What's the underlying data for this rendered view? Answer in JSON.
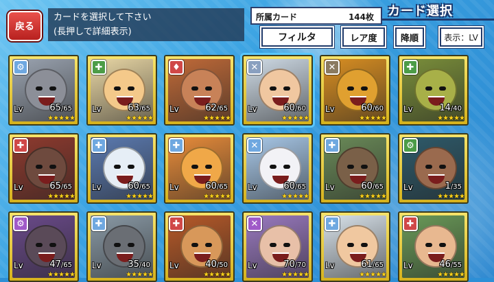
{
  "header": {
    "back_label": "戻る",
    "instruction_line1": "カードを選択して下さい",
    "instruction_line2": "(長押しで詳細表示)",
    "owned_label": "所属カード",
    "owned_count": "144枚",
    "screen_title": "カード選択",
    "filter_label": "フィルタ",
    "rarity_label": "レア度",
    "sort_label": "降順",
    "view_label": "表示：LV"
  },
  "cards": [
    {
      "icon": "⚙",
      "lv_label": "Lv",
      "level": "65",
      "max": "/65",
      "stars": "★★★★★",
      "icon_color": "#6fa8e0",
      "art_bg": "#9aa3b0",
      "face": "#8c8f98",
      "selected": false
    },
    {
      "icon": "✚",
      "lv_label": "Lv",
      "level": "63",
      "max": "/65",
      "stars": "★★★★★",
      "icon_color": "#4c9c47",
      "art_bg": "#e8d6a4",
      "face": "#f4c98a",
      "selected": false
    },
    {
      "icon": "♦",
      "lv_label": "Lv",
      "level": "62",
      "max": "/65",
      "stars": "★★★★★",
      "icon_color": "#d04848",
      "art_bg": "#c06a38",
      "face": "#c88258",
      "selected": false
    },
    {
      "icon": "✕",
      "lv_label": "Lv",
      "level": "60",
      "max": "/60",
      "stars": "★★★★★",
      "icon_color": "#8aa0c0",
      "art_bg": "#cfdbe6",
      "face": "#f0c7a0",
      "selected": true
    },
    {
      "icon": "✕",
      "lv_label": "Lv",
      "level": "60",
      "max": "/60",
      "stars": "★★★★★",
      "icon_color": "#8a7a60",
      "art_bg": "#d88e22",
      "face": "#e0a030",
      "selected": false
    },
    {
      "icon": "✚",
      "lv_label": "Lv",
      "level": "14",
      "max": "/40",
      "stars": "★★★★★",
      "icon_color": "#4c9c47",
      "art_bg": "#7a8e3a",
      "face": "#a8b048",
      "selected": false
    },
    {
      "icon": "✚",
      "lv_label": "Lv",
      "level": "65",
      "max": "/65",
      "stars": "★★★★★",
      "icon_color": "#d04848",
      "art_bg": "#8e3a2e",
      "face": "#6e4a3e",
      "selected": false
    },
    {
      "icon": "✚",
      "lv_label": "Lv",
      "level": "60",
      "max": "/65",
      "stars": "★★★★★",
      "icon_color": "#6fa8e0",
      "art_bg": "#5b7ab0",
      "face": "#e6eef6",
      "selected": false
    },
    {
      "icon": "✚",
      "lv_label": "Lv",
      "level": "60",
      "max": "/65",
      "stars": "★★★★★",
      "icon_color": "#6fa8e0",
      "art_bg": "#e88c3a",
      "face": "#f0a848",
      "selected": false
    },
    {
      "icon": "✕",
      "lv_label": "Lv",
      "level": "60",
      "max": "/65",
      "stars": "★★★★★",
      "icon_color": "#6fa8e0",
      "art_bg": "#a8c8e8",
      "face": "#f2f2f6",
      "selected": false
    },
    {
      "icon": "✚",
      "lv_label": "Lv",
      "level": "60",
      "max": "/65",
      "stars": "★★★★★",
      "icon_color": "#6fa8e0",
      "art_bg": "#6a8a58",
      "face": "#7a6048",
      "selected": false
    },
    {
      "icon": "⚙",
      "lv_label": "Lv",
      "level": "1",
      "max": "/35",
      "stars": "★★★★★",
      "icon_color": "#4c9c47",
      "art_bg": "#2e5a6a",
      "face": "#9a6a4e",
      "selected": false
    },
    {
      "icon": "⚙",
      "lv_label": "Lv",
      "level": "47",
      "max": "/65",
      "stars": "★★★★★",
      "icon_color": "#a05ac8",
      "art_bg": "#6a4a8a",
      "face": "#5a4a58",
      "selected": false
    },
    {
      "icon": "✚",
      "lv_label": "Lv",
      "level": "35",
      "max": "/40",
      "stars": "★★★★★",
      "icon_color": "#6fa8e0",
      "art_bg": "#8a9aa6",
      "face": "#6a6e74",
      "selected": false
    },
    {
      "icon": "✚",
      "lv_label": "Lv",
      "level": "40",
      "max": "/50",
      "stars": "★★★★★",
      "icon_color": "#d04848",
      "art_bg": "#b85a28",
      "face": "#d8985a",
      "selected": false
    },
    {
      "icon": "✕",
      "lv_label": "Lv",
      "level": "70",
      "max": "/70",
      "stars": "★★★★★",
      "icon_color": "#a05ac8",
      "art_bg": "#9a7ac0",
      "face": "#e8c0a8",
      "selected": false
    },
    {
      "icon": "✚",
      "lv_label": "Lv",
      "level": "61",
      "max": "/65",
      "stars": "★★★★★",
      "icon_color": "#6fa8e0",
      "art_bg": "#d8e2ea",
      "face": "#f0c8a0",
      "selected": false
    },
    {
      "icon": "✚",
      "lv_label": "Lv",
      "level": "46",
      "max": "/55",
      "stars": "★★★★★",
      "icon_color": "#d04848",
      "art_bg": "#6a9a58",
      "face": "#e8b890",
      "selected": false
    }
  ]
}
